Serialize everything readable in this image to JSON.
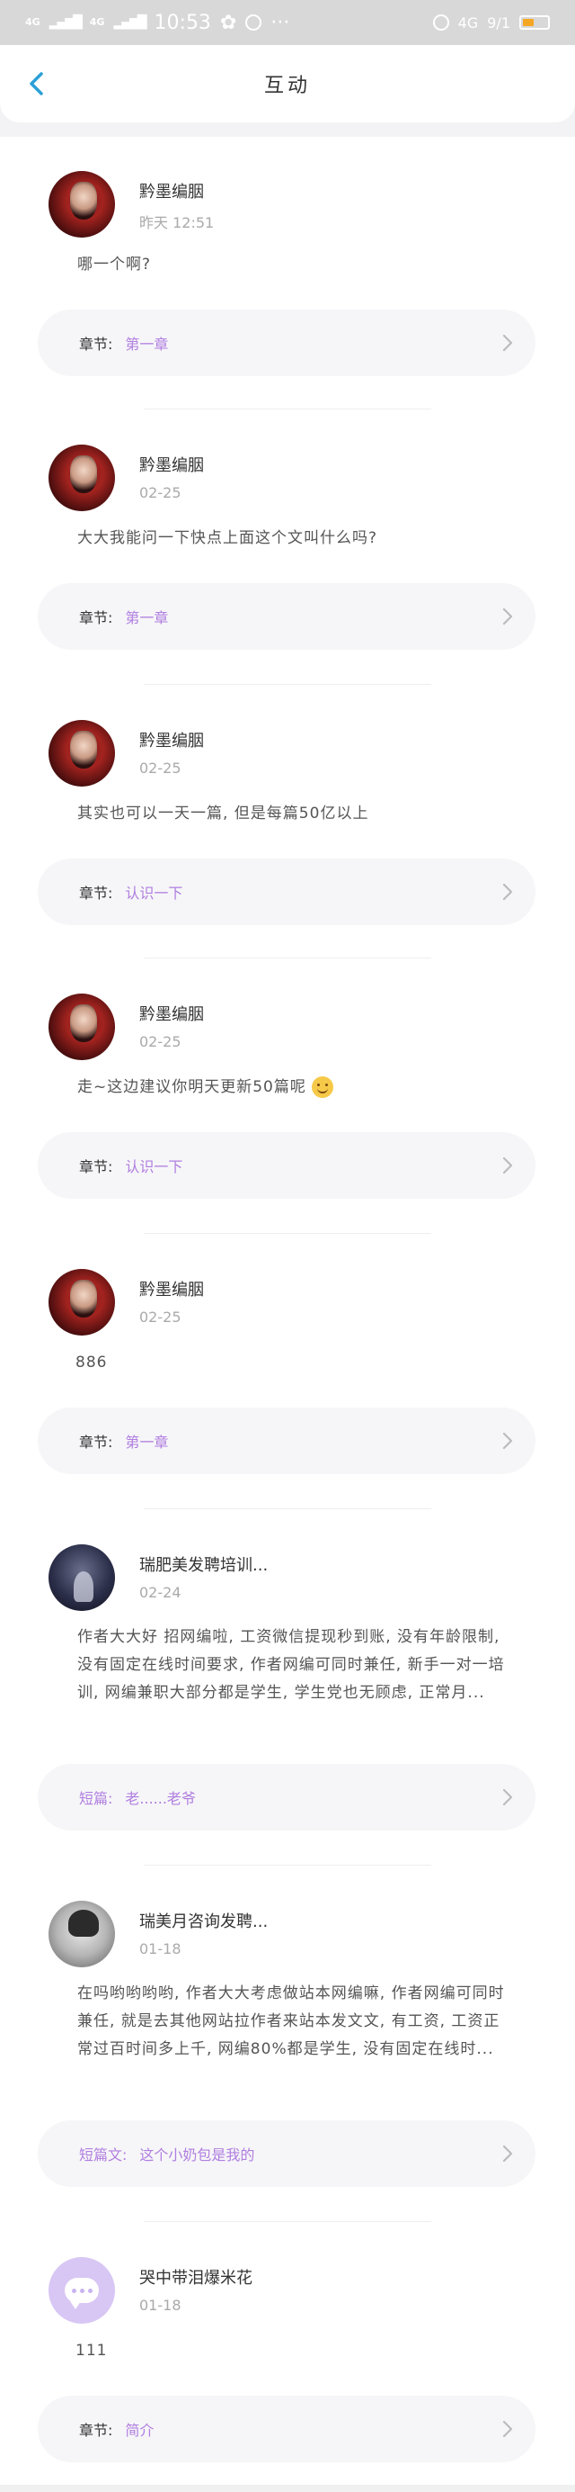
{
  "statusbar": {
    "signal": "4G",
    "time": "10:53",
    "network": "4G",
    "battery_text": "9/1",
    "battery_level": 0.45
  },
  "header": {
    "title": "互动"
  },
  "items": [
    {
      "name": "黔墨编胭",
      "date": "昨天 12:51",
      "content": "哪一个啊?",
      "chapter_label": "章节:",
      "chapter_value": "第一章"
    },
    {
      "name": "黔墨编胭",
      "date": "02-25",
      "content": "大大我能问一下快点上面这个文叫什么吗?",
      "chapter_label": "章节:",
      "chapter_value": "第一章"
    },
    {
      "name": "黔墨编胭",
      "date": "02-25",
      "content": "其实也可以一天一篇, 但是每篇50亿以上",
      "chapter_label": "章节:",
      "chapter_value": "认识一下"
    },
    {
      "name": "黔墨编胭",
      "date": "02-25",
      "content": "走~这边建议你明天更新50篇呢",
      "chapter_label": "章节:",
      "chapter_value": "认识一下"
    },
    {
      "name": "黔墨编胭",
      "date": "02-25",
      "content": "886",
      "chapter_label": "章节:",
      "chapter_value": "第一章"
    },
    {
      "name": "瑞肥美发聘培训...",
      "date": "02-24",
      "content": "作者大大好 招网编啦, 工资微信提现秒到账, 没有年龄限制, 没有固定在线时间要求, 作者网编可同时兼任, 新手一对一培训, 网编兼职大部分都是学生, 学生党也无顾虑, 正常月...",
      "chapter_label": "短篇:",
      "chapter_value": "老......老爷"
    },
    {
      "name": "瑞美月咨询发聘...",
      "date": "01-18",
      "content": "在吗哟哟哟哟, 作者大大考虑做站本网编嘛, 作者网编可同时兼任, 就是去其他网站拉作者来站本发文文, 有工资, 工资正常过百时间多上千, 网编80%都是学生, 没有固定在线时...",
      "chapter_label": "短篇文:",
      "chapter_value": "这个小奶包是我的"
    },
    {
      "name": "哭中带泪爆米花",
      "date": "01-18",
      "content": "111",
      "chapter_label": "章节:",
      "chapter_value": "简介"
    }
  ],
  "colors": {
    "accent": "#2aa0d8",
    "chapter_value": "#b07ee0",
    "background": "#f3f3f5"
  }
}
